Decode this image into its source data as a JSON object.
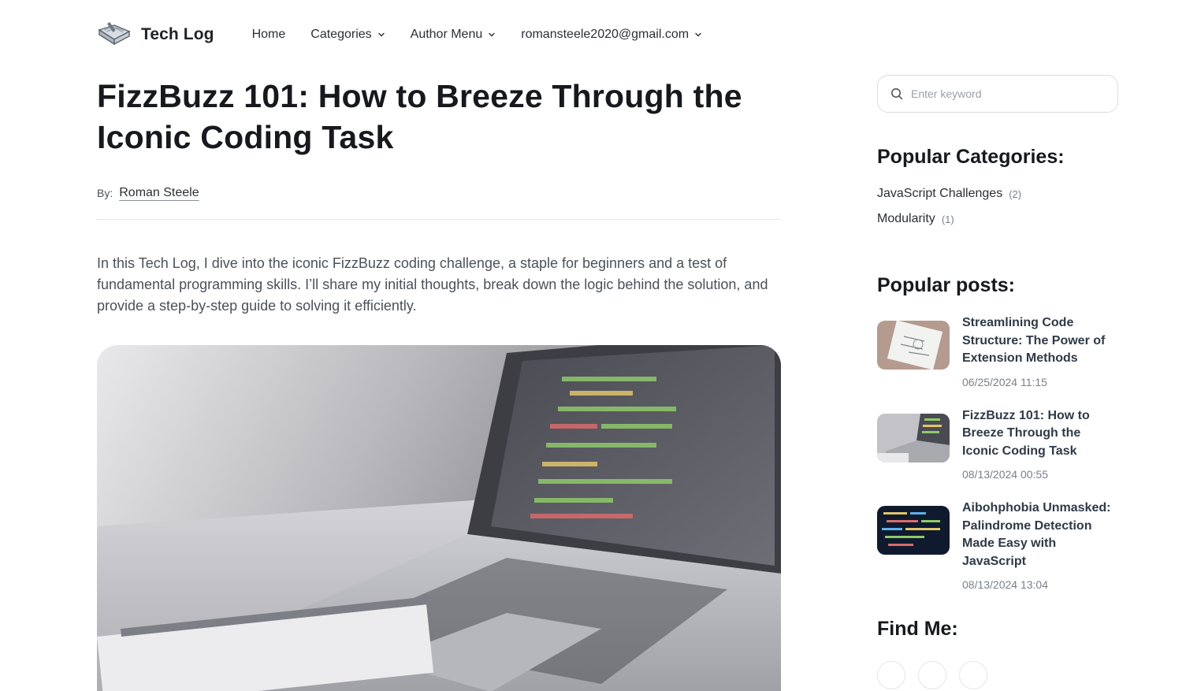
{
  "header": {
    "logo_text": "Tech Log",
    "nav": [
      {
        "label": "Home",
        "dropdown": false
      },
      {
        "label": "Categories",
        "dropdown": true
      },
      {
        "label": "Author Menu",
        "dropdown": true
      },
      {
        "label": "romansteele2020@gmail.com",
        "dropdown": true
      }
    ]
  },
  "article": {
    "title": "FizzBuzz 101: How to Breeze Through the Iconic Coding Task",
    "by_label": "By:",
    "author": "Roman Steele",
    "intro": "In this Tech Log, I dive into the iconic FizzBuzz coding challenge, a staple for beginners and a test of fundamental programming skills. I’ll share my initial thoughts, break down the logic behind the solution, and provide a step-by-step guide to solving it efficiently."
  },
  "sidebar": {
    "search_placeholder": "Enter keyword",
    "categories_heading": "Popular Categories:",
    "categories": [
      {
        "name": "JavaScript Challenges",
        "count": "(2)"
      },
      {
        "name": "Modularity",
        "count": "(1)"
      }
    ],
    "posts_heading": "Popular posts:",
    "posts": [
      {
        "title": "Streamlining Code Structure: The Power of Extension Methods",
        "date": "06/25/2024 11:15"
      },
      {
        "title": "FizzBuzz 101: How to Breeze Through the Iconic Coding Task",
        "date": "08/13/2024 00:55"
      },
      {
        "title": "Aibohphobia Unmasked: Palindrome Detection Made Easy with JavaScript",
        "date": "08/13/2024 13:04"
      }
    ],
    "find_heading": "Find Me:"
  },
  "colors": {
    "text": "#16191d",
    "muted": "#7a8089",
    "border": "#e4e6ea"
  }
}
